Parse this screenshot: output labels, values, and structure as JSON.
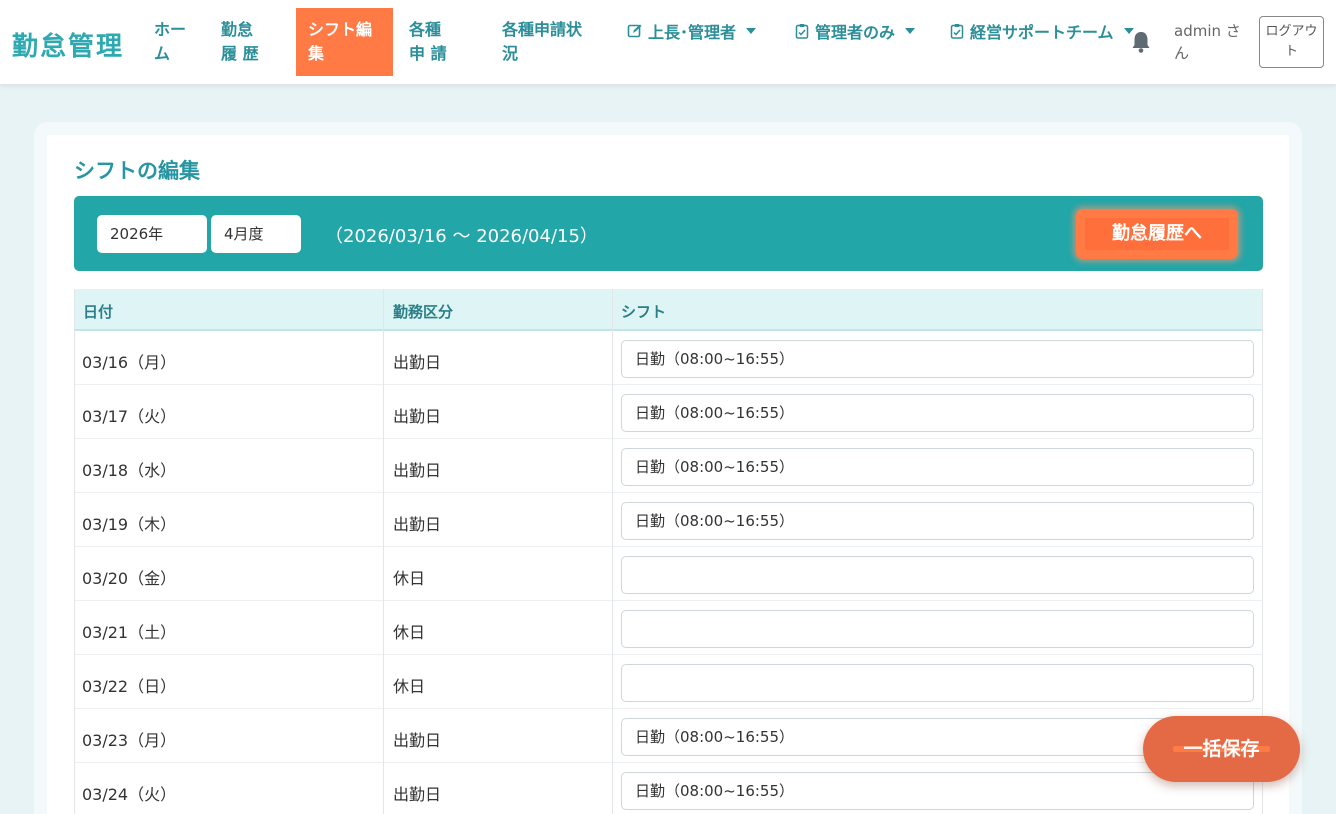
{
  "header": {
    "brand": "勤怠管理",
    "nav": [
      {
        "label": "ホー ム"
      },
      {
        "label": "勤怠履 歴"
      },
      {
        "label": "シフト編 集",
        "active": true
      },
      {
        "label": "各種申 請"
      },
      {
        "label": "各種申請状 況"
      }
    ],
    "dropdowns": [
      {
        "label": "上長･管理者",
        "icon": "edit-icon"
      },
      {
        "label": "管理者のみ",
        "icon": "clipboard-check-icon"
      },
      {
        "label": "経営サポートチーム",
        "icon": "clipboard-check-icon"
      }
    ],
    "user_label": "admin さ ん",
    "logout_label": "ログアウ ト"
  },
  "page": {
    "title": "シフトの編集",
    "year_select": "2026年",
    "month_select": "4月度",
    "range": "（2026/03/16 〜 2026/04/15）",
    "history_button": "勤怠履歴へ",
    "save_button": "一括保存"
  },
  "table": {
    "headers": [
      "日付",
      "勤務区分",
      "シフト"
    ],
    "rows": [
      {
        "date": "03/16（月）",
        "type": "出勤日",
        "shift": "日勤（08:00~16:55）"
      },
      {
        "date": "03/17（火）",
        "type": "出勤日",
        "shift": "日勤（08:00~16:55）"
      },
      {
        "date": "03/18（水）",
        "type": "出勤日",
        "shift": "日勤（08:00~16:55）"
      },
      {
        "date": "03/19（木）",
        "type": "出勤日",
        "shift": "日勤（08:00~16:55）"
      },
      {
        "date": "03/20（金）",
        "type": "休日",
        "shift": ""
      },
      {
        "date": "03/21（土）",
        "type": "休日",
        "shift": ""
      },
      {
        "date": "03/22（日）",
        "type": "休日",
        "shift": ""
      },
      {
        "date": "03/23（月）",
        "type": "出勤日",
        "shift": "日勤（08:00~16:55）"
      },
      {
        "date": "03/24（火）",
        "type": "出勤日",
        "shift": "日勤（08:00~16:55）"
      }
    ]
  },
  "colors": {
    "brand": "#2fa9b1",
    "accent": "#ff7a45",
    "filter_bar": "#22a6a8"
  }
}
